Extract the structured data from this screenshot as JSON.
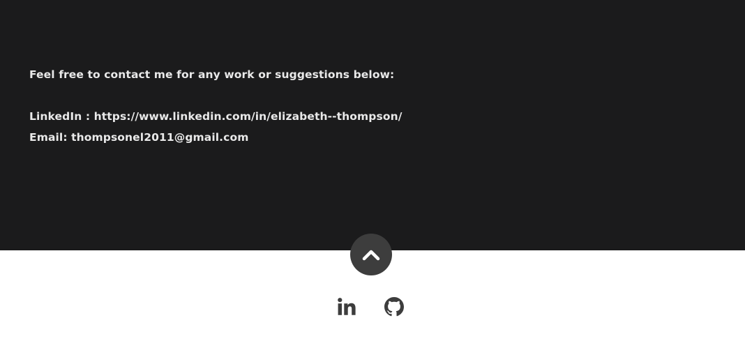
{
  "contact": {
    "intro": "Feel free to contact me for any work or suggestions below:",
    "linkedin_label": "LinkedIn : ",
    "linkedin_url": "https://www.linkedin.com/in/elizabeth--thompson/",
    "email_label": "Email: ",
    "email": "thompsonel2011@gmail.com"
  },
  "footer": {
    "back_to_top_icon": "chevron-up-icon",
    "social": [
      {
        "icon": "linkedin-icon"
      },
      {
        "icon": "github-icon"
      }
    ]
  },
  "colors": {
    "section_bg": "#1b1b1c",
    "text": "#e9e9e9",
    "button_bg": "#3d3d3d",
    "icon": "#3d3d3d",
    "footer_bg": "#ffffff"
  }
}
